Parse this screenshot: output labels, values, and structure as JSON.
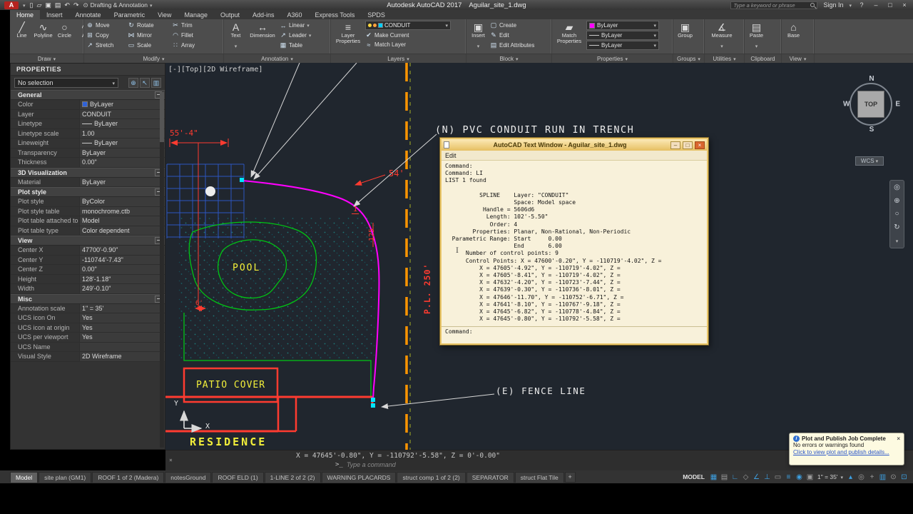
{
  "title_bar": {
    "logo": "A",
    "qat_icons": [
      {
        "name": "new-icon",
        "glyph": "▯"
      },
      {
        "name": "open-icon",
        "glyph": "▱"
      },
      {
        "name": "save-icon",
        "glyph": "▣"
      },
      {
        "name": "plot-icon",
        "glyph": "▤"
      },
      {
        "name": "undo-icon",
        "glyph": "↶"
      },
      {
        "name": "redo-icon",
        "glyph": "↷"
      }
    ],
    "workspace": "Drafting & Annotation",
    "app_title": "Autodesk AutoCAD 2017",
    "doc_title": "Aguilar_site_1.dwg",
    "search_placeholder": "Type a keyword or phrase",
    "sign_in": "Sign In",
    "help": "?"
  },
  "ribbon": {
    "tabs": [
      {
        "label": "Home",
        "active": true
      },
      {
        "label": "Insert"
      },
      {
        "label": "Annotate"
      },
      {
        "label": "Parametric"
      },
      {
        "label": "View"
      },
      {
        "label": "Manage"
      },
      {
        "label": "Output"
      },
      {
        "label": "Add-ins"
      },
      {
        "label": "A360"
      },
      {
        "label": "Express Tools"
      },
      {
        "label": "SPDS"
      }
    ],
    "draw": {
      "label": "Draw",
      "items": [
        {
          "label": "Line",
          "glyph": "╱"
        },
        {
          "label": "Polyline",
          "glyph": "∿"
        },
        {
          "label": "Circle",
          "glyph": "○"
        },
        {
          "label": "Arc",
          "glyph": "◠"
        }
      ]
    },
    "modify": {
      "label": "Modify",
      "items": [
        {
          "label": "Move",
          "glyph": "⊕"
        },
        {
          "label": "Rotate",
          "glyph": "↻"
        },
        {
          "label": "Trim",
          "glyph": "✂"
        },
        {
          "label": "Copy",
          "glyph": "⊞"
        },
        {
          "label": "Mirror",
          "glyph": "⋈"
        },
        {
          "label": "Fillet",
          "glyph": "◠"
        },
        {
          "label": "Stretch",
          "glyph": "↗"
        },
        {
          "label": "Scale",
          "glyph": "▭"
        },
        {
          "label": "Array",
          "glyph": "∷"
        }
      ]
    },
    "annotation": {
      "label": "Annotation",
      "text": {
        "label": "Text",
        "glyph": "A"
      },
      "dimension": {
        "label": "Dimension",
        "glyph": "↔"
      },
      "items": [
        {
          "label": "Linear",
          "glyph": "↔",
          "caret": true
        },
        {
          "label": "Leader",
          "glyph": "↗",
          "caret": true
        },
        {
          "label": "Table",
          "glyph": "▦"
        }
      ]
    },
    "layers": {
      "label": "Layers",
      "big": {
        "label": "Layer Properties",
        "glyph": "≡"
      },
      "current_layer": "CONDUIT",
      "layer_color": "#00cfff",
      "buttons": [
        {
          "label": "Make Current",
          "glyph": "✔"
        },
        {
          "label": "Match Layer",
          "glyph": "≈"
        }
      ]
    },
    "block": {
      "label": "Block",
      "big": {
        "label": "Insert",
        "glyph": "▣"
      },
      "items": [
        {
          "label": "Create",
          "glyph": "▢"
        },
        {
          "label": "Edit",
          "glyph": "✎"
        },
        {
          "label": "Edit Attributes",
          "glyph": "▤"
        }
      ]
    },
    "properties": {
      "label": "Properties",
      "big": {
        "label": "Match Properties",
        "glyph": "▰"
      },
      "dropdowns": [
        {
          "label": "ByLayer",
          "swatch": "#ff00ff"
        },
        {
          "label": "ByLayer",
          "line": true
        },
        {
          "label": "ByLayer",
          "line": true
        }
      ]
    },
    "groups": {
      "label": "Groups",
      "big": {
        "label": "Group",
        "glyph": "▣"
      }
    },
    "utilities": {
      "label": "Util",
      "big": {
        "label": "Measure",
        "glyph": "∡"
      }
    },
    "utilities_label": "Utilities",
    "clipboard": {
      "label": "Clipboard",
      "big": {
        "label": "Paste",
        "glyph": "▤"
      }
    },
    "view": {
      "label": "View",
      "big": {
        "label": "Base",
        "glyph": "⌂"
      }
    }
  },
  "properties_palette": {
    "title": "PROPERTIES",
    "selection": "No selection",
    "toolbar_icons": [
      {
        "name": "pickadd-toggle-icon",
        "glyph": "⊕"
      },
      {
        "name": "select-objects-icon",
        "glyph": "↖"
      },
      {
        "name": "quick-select-icon",
        "glyph": "▥"
      }
    ],
    "sections": [
      {
        "name": "General",
        "rows": [
          {
            "label": "Color",
            "value": "ByLayer",
            "swatch": "#2f62d9"
          },
          {
            "label": "Layer",
            "value": "CONDUIT"
          },
          {
            "label": "Linetype",
            "value": "ByLayer",
            "line": true
          },
          {
            "label": "Linetype scale",
            "value": "1.00"
          },
          {
            "label": "Lineweight",
            "value": "ByLayer",
            "line": true
          },
          {
            "label": "Transparency",
            "value": "ByLayer"
          },
          {
            "label": "Thickness",
            "value": "0.00\""
          }
        ]
      },
      {
        "name": "3D Visualization",
        "rows": [
          {
            "label": "Material",
            "value": "ByLayer"
          }
        ]
      },
      {
        "name": "Plot style",
        "rows": [
          {
            "label": "Plot style",
            "value": "ByColor"
          },
          {
            "label": "Plot style table",
            "value": "monochrome.ctb"
          },
          {
            "label": "Plot table attached to",
            "value": "Model"
          },
          {
            "label": "Plot table type",
            "value": "Color dependent"
          }
        ]
      },
      {
        "name": "View",
        "rows": [
          {
            "label": "Center X",
            "value": "47700'-0.90\""
          },
          {
            "label": "Center Y",
            "value": "-110744'-7.43\""
          },
          {
            "label": "Center Z",
            "value": "0.00\""
          },
          {
            "label": "Height",
            "value": "128'-1.18\""
          },
          {
            "label": "Width",
            "value": "249'-0.10\""
          }
        ]
      },
      {
        "name": "Misc",
        "rows": [
          {
            "label": "Annotation scale",
            "value": "1\" = 35'"
          },
          {
            "label": "UCS icon On",
            "value": "Yes"
          },
          {
            "label": "UCS icon at origin",
            "value": "Yes"
          },
          {
            "label": "UCS per viewport",
            "value": "Yes"
          },
          {
            "label": "UCS Name",
            "value": ""
          },
          {
            "label": "Visual Style",
            "value": "2D Wireframe"
          }
        ]
      }
    ]
  },
  "viewport": {
    "label": "[-][Top][2D Wireframe]"
  },
  "drawing": {
    "conduit_note": "(N) PVC CONDUIT RUN IN TRENCH",
    "fence_note": "(E) FENCE LINE",
    "pool": "POOL",
    "patio": "PATIO COVER",
    "residence": "RESIDENCE",
    "dim_55": "55'-4\"",
    "dim_54": "54'",
    "dim_1": "1",
    "dim_125": "125'",
    "dim_6": "6'",
    "pl_line": "P.L. 250'",
    "axis_x": "X",
    "axis_y": "Y"
  },
  "text_window": {
    "title": "AutoCAD Text Window - Aguilar_site_1.dwg",
    "menu": "Edit",
    "lines": [
      "Command:",
      "Command: LI",
      "LIST 1 found",
      "",
      "          SPLINE    Layer: \"CONDUIT\"",
      "                    Space: Model space",
      "           Handle = 5606d6",
      "            Length: 102'-5.50\"",
      "             Order: 4",
      "        Properties: Planar, Non-Rational, Non-Periodic",
      "  Parametric Range: Start     0.00",
      "                    End       6.00",
      "      Number of control points: 9",
      "      Control Points: X = 47600'-0.20\", Y = -110719'-4.02\", Z =",
      "          X = 47605'-4.92\", Y = -110719'-4.02\", Z =",
      "          X = 47605'-8.41\", Y = -110719'-4.02\", Z =",
      "          X = 47632'-4.20\", Y = -110723'-7.44\", Z =",
      "          X = 47639'-0.30\", Y = -110736'-8.01\", Z =",
      "          X = 47646'-11.70\", Y = -110752'-6.71\", Z =",
      "          X = 47641'-8.10\", Y = -110767'-9.18\", Z =",
      "          X = 47645'-6.82\", Y = -110778'-4.84\", Z =",
      "          X = 47645'-0.80\", Y = -110792'-5.58\", Z ="
    ],
    "prompt": "Command:"
  },
  "viewcube": {
    "n": "N",
    "s": "S",
    "e": "E",
    "w": "W",
    "top": "TOP",
    "wcs": "WCS"
  },
  "command_bar": {
    "coords": "X = 47645'-0.80\", Y = -110792'-5.58\", Z = 0'-0.00\"",
    "placeholder": "Type a command"
  },
  "layout_tabs": [
    {
      "label": "Model",
      "active": true
    },
    {
      "label": "site plan (GM1)"
    },
    {
      "label": "ROOF 1 of 2 (Madera)"
    },
    {
      "label": "notesGround"
    },
    {
      "label": "ROOF ELD (1)"
    },
    {
      "label": "1-LINE 2 of 2 (2)"
    },
    {
      "label": "WARNING PLACARDS"
    },
    {
      "label": "struct comp 1 of 2 (2)"
    },
    {
      "label": "SEPARATOR"
    },
    {
      "label": "struct Flat Tile"
    }
  ],
  "layout_plus": "+",
  "status_bar": {
    "model": "MODEL",
    "scale": "1\" = 35'",
    "icons_left": [
      {
        "glyph": "▦",
        "active": true
      },
      {
        "glyph": "▤"
      },
      {
        "glyph": "∟",
        "active": true
      },
      {
        "glyph": "◇"
      },
      {
        "glyph": "∠",
        "active": true
      },
      {
        "glyph": "⊥",
        "active": true
      },
      {
        "glyph": "▭"
      },
      {
        "glyph": "≡",
        "active": true
      },
      {
        "glyph": "◉",
        "active": true
      },
      {
        "glyph": "▣"
      }
    ],
    "icons_right": [
      {
        "glyph": "▴",
        "active": true
      },
      {
        "glyph": "◎"
      },
      {
        "glyph": "+"
      },
      {
        "glyph": "▥",
        "active": true
      },
      {
        "glyph": "⊙"
      },
      {
        "glyph": "⊡",
        "active": true
      }
    ]
  },
  "notification": {
    "title": "Plot and Publish Job Complete",
    "body": "No errors or warnings found",
    "link": "Click to view plot and publish details..."
  }
}
